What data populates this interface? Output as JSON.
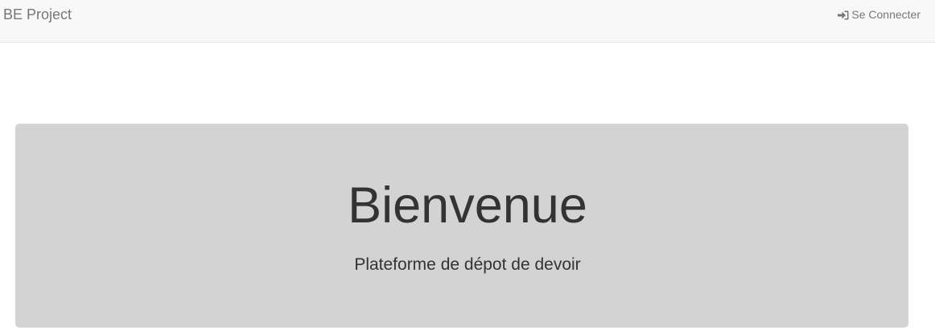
{
  "navbar": {
    "brand": "BE Project",
    "login_label": "Se Connecter",
    "login_icon": "sign-in-icon"
  },
  "jumbotron": {
    "title": "Bienvenue",
    "subtitle": "Plateforme de dépot de devoir"
  },
  "colors": {
    "navbar_bg": "#f8f8f8",
    "nav_text": "#777777",
    "jumbotron_bg": "#d3d3d3",
    "heading_text": "#333333"
  }
}
